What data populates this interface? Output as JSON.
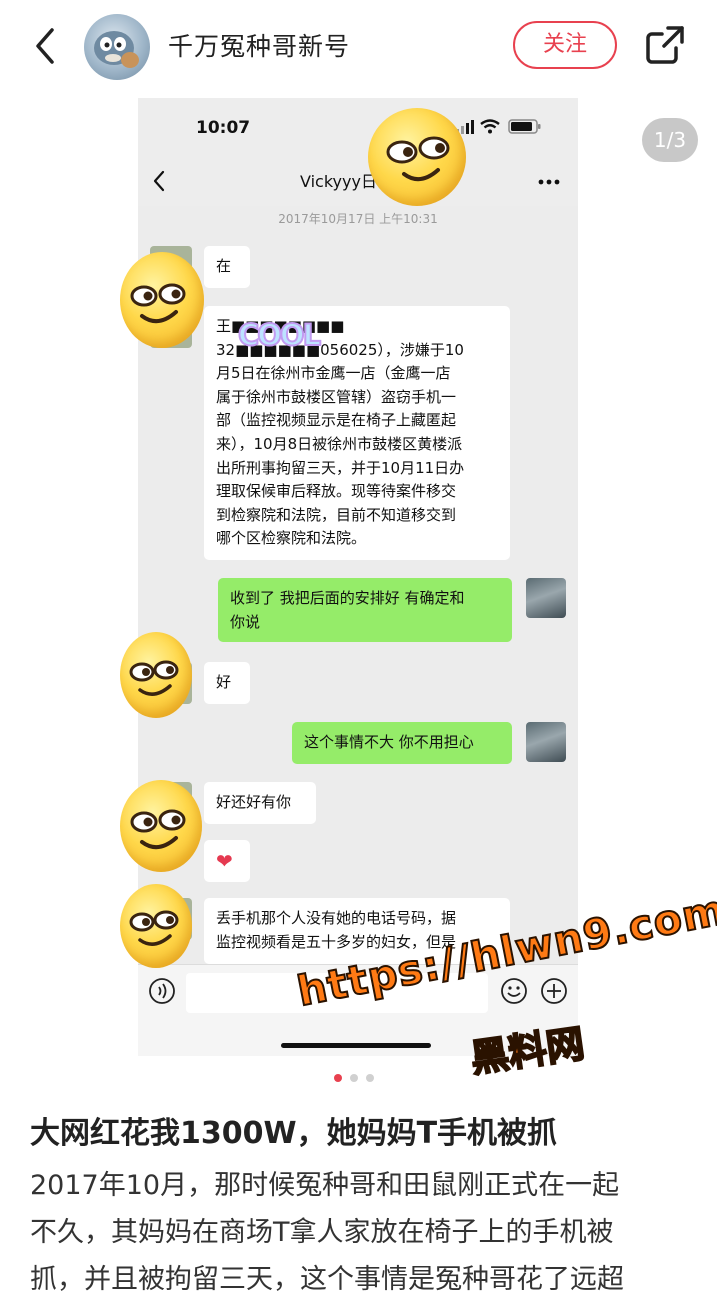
{
  "header": {
    "author_name": "千万冤种哥新号",
    "follow_label": "关注"
  },
  "carousel": {
    "page_indicator": "1/3",
    "active_index": 0,
    "dot_count": 3
  },
  "chat": {
    "status_time": "10:07",
    "contact_name": "Vickyyy日",
    "date": "2017年10月17日 上午10:31",
    "messages": [
      {
        "side": "left",
        "text": "在"
      },
      {
        "side": "left",
        "lines": [
          "王■■■■■■■■",
          "32■■■■■■056025），涉嫌于10",
          "月5日在徐州市金鹰一店（金鹰一店",
          "属于徐州市鼓楼区管辖）盗窃手机一",
          "部（监控视频显示是在椅子上藏匿起",
          "来），10月8日被徐州市鼓楼区黄楼派",
          "出所刑事拘留三天，并于10月11日办",
          "理取保候审后释放。现等待案件移交",
          "到检察院和法院，目前不知道移交到",
          "哪个区检察院和法院。"
        ]
      },
      {
        "side": "right",
        "lines": [
          "收到了 我把后面的安排好 有确定和",
          "你说"
        ]
      },
      {
        "side": "left",
        "text": "好"
      },
      {
        "side": "right",
        "text": "这个事情不大 你不用担心"
      },
      {
        "side": "left",
        "text": "好还好有你"
      },
      {
        "side": "left",
        "text": "❤"
      },
      {
        "side": "left",
        "lines": [
          "丢手机那个人没有她的电话号码，据",
          "监控视频看是五十多岁的妇女，但是"
        ]
      }
    ],
    "sticker_text": "COOL"
  },
  "watermark": {
    "url": "https://hlwn9.com",
    "name": "黑料网"
  },
  "post": {
    "title": "大网红花我1300W，她妈妈T手机被抓",
    "body_lines": [
      "2017年10月，那时候冤种哥和田鼠刚正式在一起",
      "不久，其妈妈在商场T拿人家放在椅子上的手机被",
      "抓，并且被拘留三天，这个事情是冤种哥花了远超"
    ]
  },
  "colors": {
    "accent": "#e8414f",
    "wechat_green": "#95ec69",
    "watermark_orange": "#ff7a14"
  }
}
